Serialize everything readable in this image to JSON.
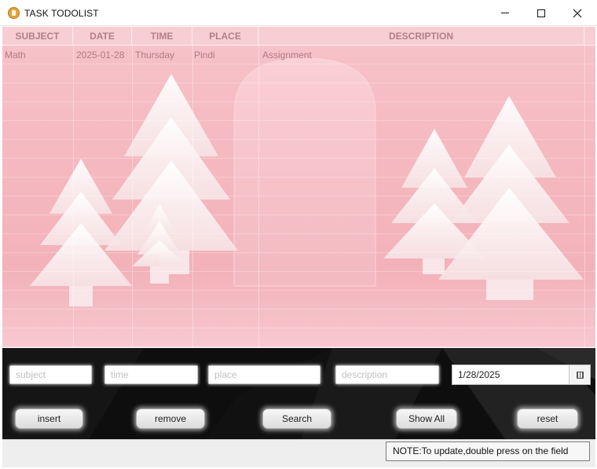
{
  "window": {
    "title": "TASK TODOLIST"
  },
  "table": {
    "columns": [
      "SUBJECT",
      "DATE",
      "TIME",
      "PLACE",
      "DESCRIPTION"
    ],
    "rows": [
      [
        "Math",
        "2025-01-28",
        "Thursday",
        "Pindi",
        "Assignment"
      ]
    ]
  },
  "form": {
    "subject_placeholder": "subject",
    "time_placeholder": "time",
    "place_placeholder": "place",
    "description_placeholder": "description",
    "date_value": "1/28/2025"
  },
  "buttons": {
    "insert": "insert",
    "remove": "remove",
    "search": "Search",
    "show_all": "Show All",
    "reset": "reset"
  },
  "note": "NOTE:To update,double press on the field",
  "colors": {
    "scene_pink": "#f5b9c0",
    "panel_dark": "#0e0e0e"
  },
  "icons": {
    "app": "app-icon",
    "calendar": "calendar-icon"
  }
}
